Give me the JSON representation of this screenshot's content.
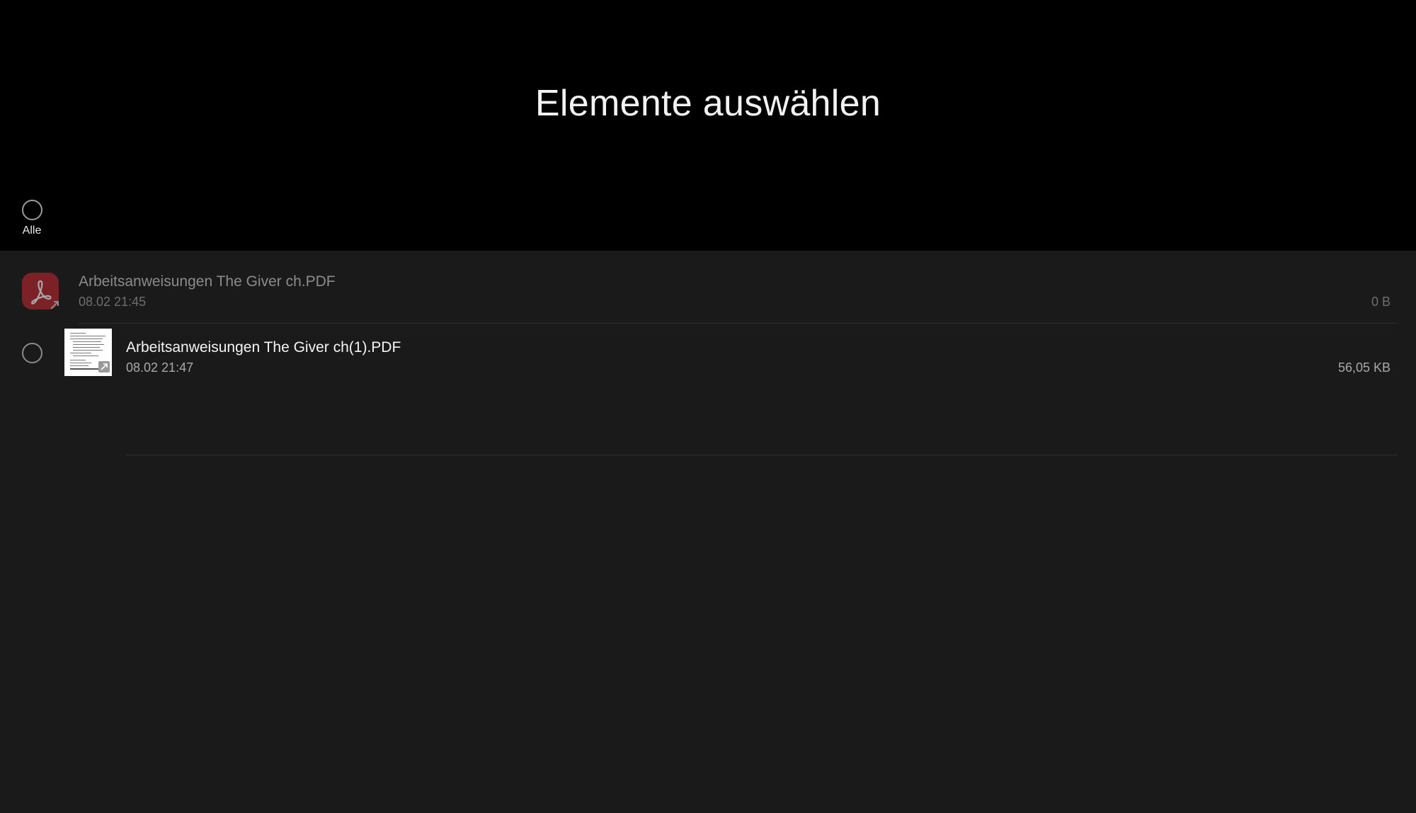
{
  "header": {
    "title": "Elemente auswählen",
    "select_all_label": "Alle"
  },
  "files": [
    {
      "name": "Arbeitsanweisungen The Giver ch.PDF",
      "date": "08.02 21:45",
      "size": "0 B",
      "icon": "pdf-app-icon",
      "disabled": true
    },
    {
      "name": "Arbeitsanweisungen The Giver ch(1).PDF",
      "date": "08.02 21:47",
      "size": "56,05 KB",
      "icon": "document-thumbnail",
      "disabled": false
    }
  ],
  "colors": {
    "header_background": "#000000",
    "list_background": "#1a1a1a",
    "pdf_red": "#b8262c"
  }
}
